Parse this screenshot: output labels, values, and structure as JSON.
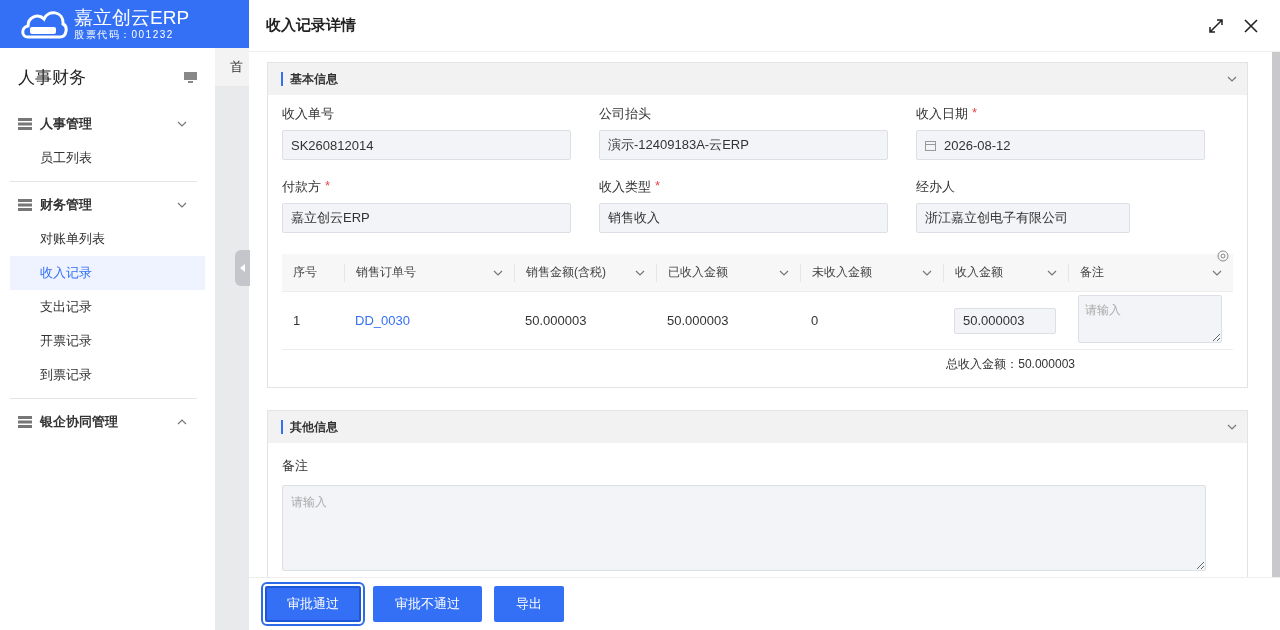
{
  "app": {
    "name": "嘉立创云ERP",
    "stock_code": "股票代码：001232"
  },
  "sidebar": {
    "title": "人事财务",
    "groups": [
      {
        "label": "人事管理",
        "expanded": true,
        "items": [
          {
            "label": "员工列表",
            "selected": false
          }
        ]
      },
      {
        "label": "财务管理",
        "expanded": true,
        "items": [
          {
            "label": "对账单列表",
            "selected": false
          },
          {
            "label": "收入记录",
            "selected": true
          },
          {
            "label": "支出记录",
            "selected": false
          },
          {
            "label": "开票记录",
            "selected": false
          },
          {
            "label": "到票记录",
            "selected": false
          }
        ]
      },
      {
        "label": "银企协同管理",
        "expanded": false
      }
    ]
  },
  "background_tab": "首",
  "drawer": {
    "title": "收入记录详情",
    "basic": {
      "title": "基本信息",
      "expanded": true,
      "fields": [
        {
          "label": "收入单号",
          "kind": "text",
          "value": "SK260812014"
        },
        {
          "label": "公司抬头",
          "kind": "text",
          "value": "演示-12409183A-云ERP"
        },
        {
          "label": "收入日期",
          "required_mark": "*",
          "kind": "date",
          "value": "2026-08-12"
        },
        {
          "label": "付款方",
          "required_mark": "*",
          "kind": "text",
          "value": "嘉立创云ERP"
        },
        {
          "label": "收入类型",
          "required_mark": "*",
          "kind": "text",
          "value": "销售收入"
        },
        {
          "label": "经办人",
          "kind": "text",
          "value": "浙江嘉立创电子有限公司"
        }
      ],
      "table": {
        "columns": [
          {
            "label": "序号",
            "menu": false
          },
          {
            "label": "销售订单号",
            "menu": true
          },
          {
            "label": "销售金额(含税)",
            "menu": true
          },
          {
            "label": "已收入金额",
            "menu": true
          },
          {
            "label": "未收入金额",
            "menu": true
          },
          {
            "label": "收入金额",
            "menu": true
          },
          {
            "label": "备注",
            "menu": true
          }
        ],
        "rows": [
          {
            "index": "1",
            "order": "DD_0030",
            "sales_amount": "50.000003",
            "received": "50.000003",
            "unreceived": "0",
            "amount": "50.000003",
            "remark_placeholder": "请输入"
          }
        ],
        "total": "总收入金额：50.000003"
      }
    },
    "other": {
      "title": "其他信息",
      "expanded": true,
      "remark_label": "备注",
      "remark_placeholder": "请输入"
    },
    "buttons": [
      {
        "label": "审批通过",
        "focused": true
      },
      {
        "label": "审批不通过",
        "focused": false
      },
      {
        "label": "导出",
        "focused": false
      }
    ]
  }
}
